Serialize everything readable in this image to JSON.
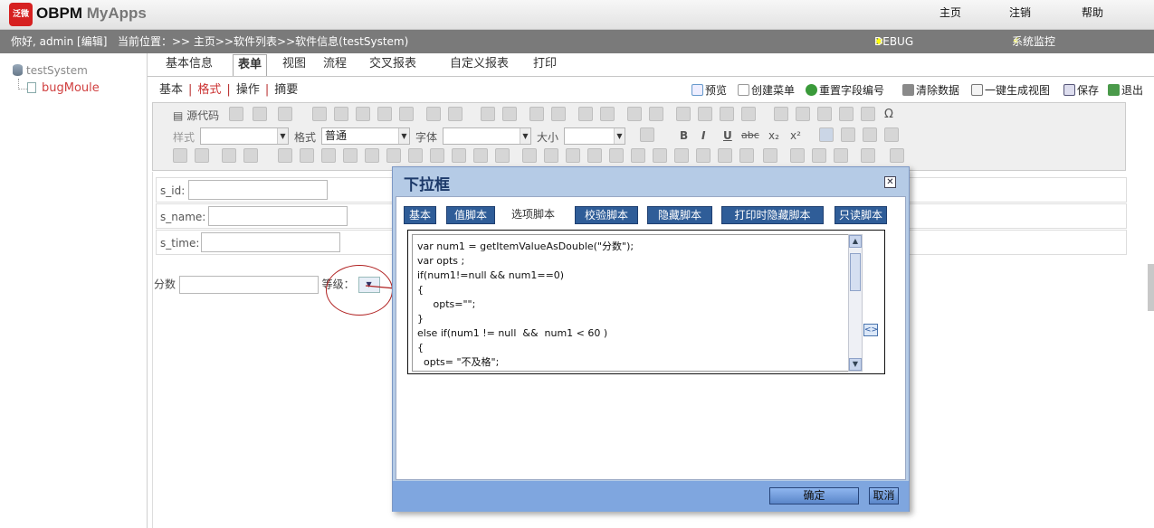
{
  "app": {
    "logo_char": "泛微",
    "name": "OBPM",
    "name_sub": "MyApps"
  },
  "topnav": {
    "home": "主页",
    "logout": "注销",
    "help": "帮助"
  },
  "navbar": {
    "greeting": "你好, admin [编辑]",
    "location": "当前位置：>> 主页>>软件列表>>软件信息(testSystem)",
    "debug": "DEBUG",
    "monitor": "系统监控"
  },
  "tree": {
    "root": "testSystem",
    "child": "bugMoule"
  },
  "tabs1": [
    "基本信息",
    "表单",
    "视图",
    "流程",
    "交叉报表",
    "自定义报表",
    "打印"
  ],
  "tabs2": [
    "基本",
    "格式",
    "操作",
    "摘要"
  ],
  "actions": [
    "预览",
    "创建菜单",
    "重置字段编号",
    "清除数据",
    "一键生成视图",
    "保存",
    "退出"
  ],
  "toolbar": {
    "source": "源代码",
    "style_label": "样式",
    "format_label": "格式",
    "format_value": "普通",
    "font_label": "字体",
    "size_label": "大小",
    "bold": "B",
    "italic": "I",
    "underline": "U",
    "strike": "abc",
    "sub": "x₂",
    "sup": "x²",
    "omega": "Ω"
  },
  "form": {
    "s_id": "s_id:",
    "s_name": "s_name:",
    "s_time": "s_time:",
    "score": "分数",
    "grade": "等级："
  },
  "dialog": {
    "title": "下拉框",
    "tabs": [
      "基本",
      "值脚本",
      "选项脚本",
      "校验脚本",
      "隐藏脚本",
      "打印时隐藏脚本",
      "只读脚本"
    ],
    "code": "var num1 = getItemValueAsDouble(\"分数\");\nvar opts ;\nif(num1!=null && num1==0)\n{\n     opts=\"\";\n}\nelse if(num1 != null  &&  num1 < 60 )\n{\n  opts= \"不及格\";",
    "ok": "确定",
    "cancel": "取消"
  }
}
